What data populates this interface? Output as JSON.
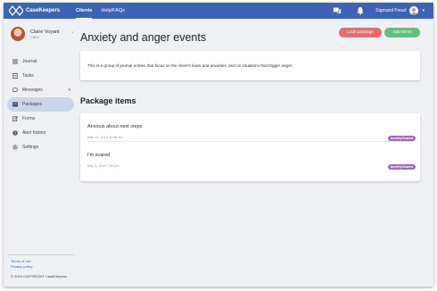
{
  "app": {
    "brand": "CaseKeepers",
    "nav": [
      {
        "label": "Clients"
      },
      {
        "label": "Help/FAQs"
      }
    ],
    "user_name": "Sigmund Freud"
  },
  "sidebar": {
    "profile_name": "Claire Voyant",
    "profile_role": "Client",
    "items": [
      {
        "label": "Journal",
        "icon": "list-icon"
      },
      {
        "label": "Tasks",
        "icon": "tasks-icon"
      },
      {
        "label": "Messages",
        "icon": "chat-bubble-icon"
      },
      {
        "label": "Packages",
        "icon": "package-icon"
      },
      {
        "label": "Forms",
        "icon": "form-icon"
      },
      {
        "label": "Alert history",
        "icon": "alert-icon"
      },
      {
        "label": "Settings",
        "icon": "gear-icon"
      }
    ],
    "footer": {
      "terms": "Terms of use",
      "privacy": "Privacy policy",
      "copyright": "© 2019 COPYRIGHT CaseKeepers"
    }
  },
  "page": {
    "title": "Anxiety and anger events",
    "lock_button": "Lock package",
    "add_button": "Add items",
    "description": "This is a group of journal entries that focus on the client's fears and anxieties, and on situations that trigger anger.",
    "section_title": "Package items",
    "items": [
      {
        "title": "Anxious about next steps",
        "date": "May 14, 2019 11:46 am",
        "tag": "Anxiety/Scared"
      },
      {
        "title": "I'm scared",
        "date": "May 8, 2019 7:40 pm",
        "tag": "Anxiety/Scared"
      }
    ]
  },
  "colors": {
    "topbar": "#3a64b8",
    "lock_button": "#e96b6b",
    "add_button": "#5cc27d",
    "tag": "#a36ab8",
    "active_menu": "#c9d6ea"
  }
}
